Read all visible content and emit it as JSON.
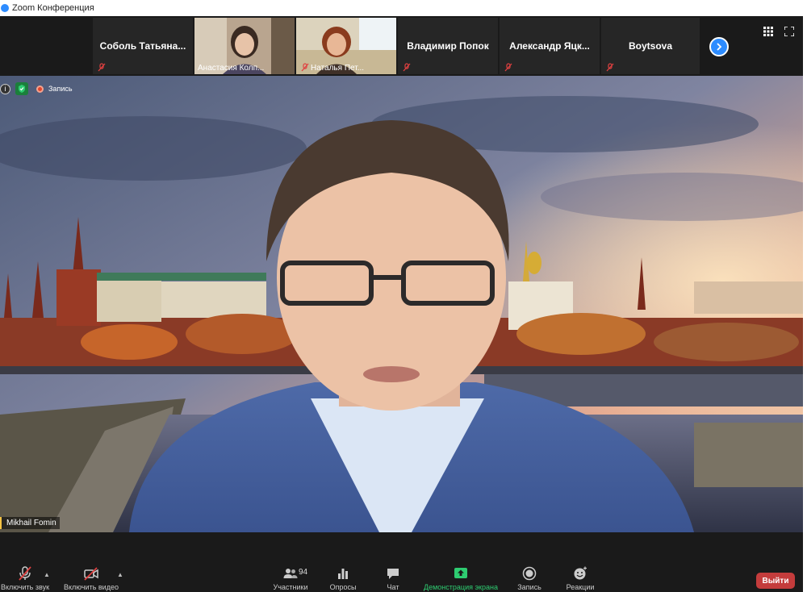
{
  "window": {
    "title": "Zoom Конференция"
  },
  "gallery": {
    "tiles": [
      {
        "name": "Соболь  Татьяна...",
        "type": "name"
      },
      {
        "name": "Анастасия Колп...",
        "type": "video"
      },
      {
        "name": "Наталья Пет...",
        "type": "video"
      },
      {
        "name": "Владимир Попок",
        "type": "name"
      },
      {
        "name": "Александр  Яцк...",
        "type": "name"
      },
      {
        "name": "Boytsova",
        "type": "name"
      }
    ]
  },
  "main": {
    "recording_label": "Запись",
    "speaker_name": "Mikhail Fomin"
  },
  "toolbar": {
    "unmute": "Включить звук",
    "start_video": "Включить видео",
    "participants": "Участники",
    "participants_count": "94",
    "polls": "Опросы",
    "chat": "Чат",
    "share_screen": "Демонстрация экрана",
    "record": "Запись",
    "reactions": "Реакции",
    "leave": "Выйти"
  },
  "colors": {
    "accent": "#2d8cff",
    "share_green": "#2ecc71",
    "leave_red": "#c43c3c",
    "muted_red": "#e04040"
  }
}
